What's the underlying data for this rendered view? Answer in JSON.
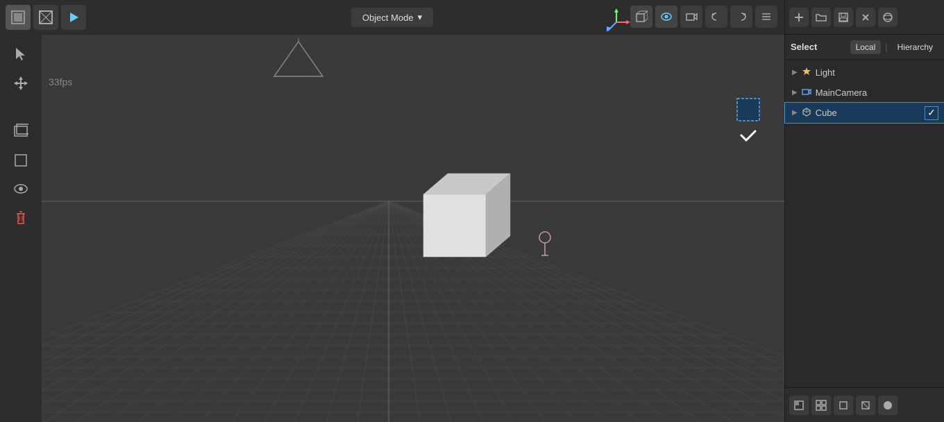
{
  "viewport": {
    "mode_label": "Object Mode",
    "fps": "33fps"
  },
  "toolbar": {
    "buttons": [
      "⬜",
      "▶",
      "↺",
      "✛"
    ]
  },
  "select_bar": {
    "select_label": "Select",
    "local_label": "Local",
    "hierarchy_label": "Hierarchy"
  },
  "hierarchy": {
    "items": [
      {
        "id": "light",
        "label": "Light",
        "icon": "light",
        "selected": false
      },
      {
        "id": "maincamera",
        "label": "MainCamera",
        "icon": "camera",
        "selected": false
      },
      {
        "id": "cube",
        "label": "Cube",
        "icon": "cube",
        "selected": true
      }
    ]
  },
  "view_controls": {
    "buttons": [
      "⊙",
      "⬡",
      "👁",
      "📷",
      "⟲",
      "⟳",
      "☰"
    ]
  },
  "bottom_panel": {
    "icons": [
      "⬛",
      "⊞",
      "◻",
      "◻",
      "⬤"
    ]
  }
}
